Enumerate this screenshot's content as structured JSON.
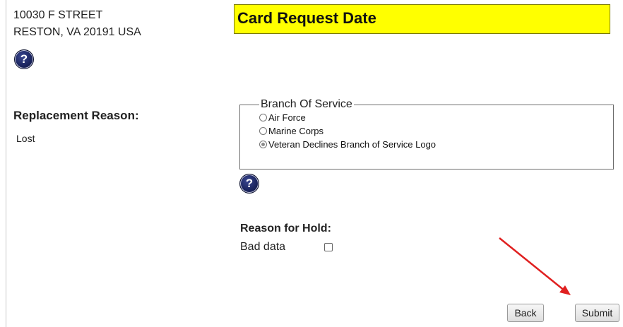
{
  "address": {
    "line1": "10030 F STREET",
    "line2": "RESTON, VA 20191 USA"
  },
  "help_icon_glyph": "?",
  "card_request": {
    "title": "Card Request Date"
  },
  "replacement": {
    "label": "Replacement Reason:",
    "value": "Lost"
  },
  "branch_of_service": {
    "legend": "Branch Of Service",
    "options": [
      {
        "label": "Air Force",
        "selected": false
      },
      {
        "label": "Marine Corps",
        "selected": false
      },
      {
        "label": "Veteran Declines Branch of Service Logo",
        "selected": true
      }
    ]
  },
  "hold": {
    "label": "Reason for Hold:",
    "bad_data_label": "Bad data",
    "bad_data_checked": false
  },
  "buttons": {
    "back": "Back",
    "submit": "Submit"
  },
  "colors": {
    "title_highlight": "#ffff00",
    "annotation_arrow": "#e02020",
    "help_icon": "#1b2560"
  }
}
